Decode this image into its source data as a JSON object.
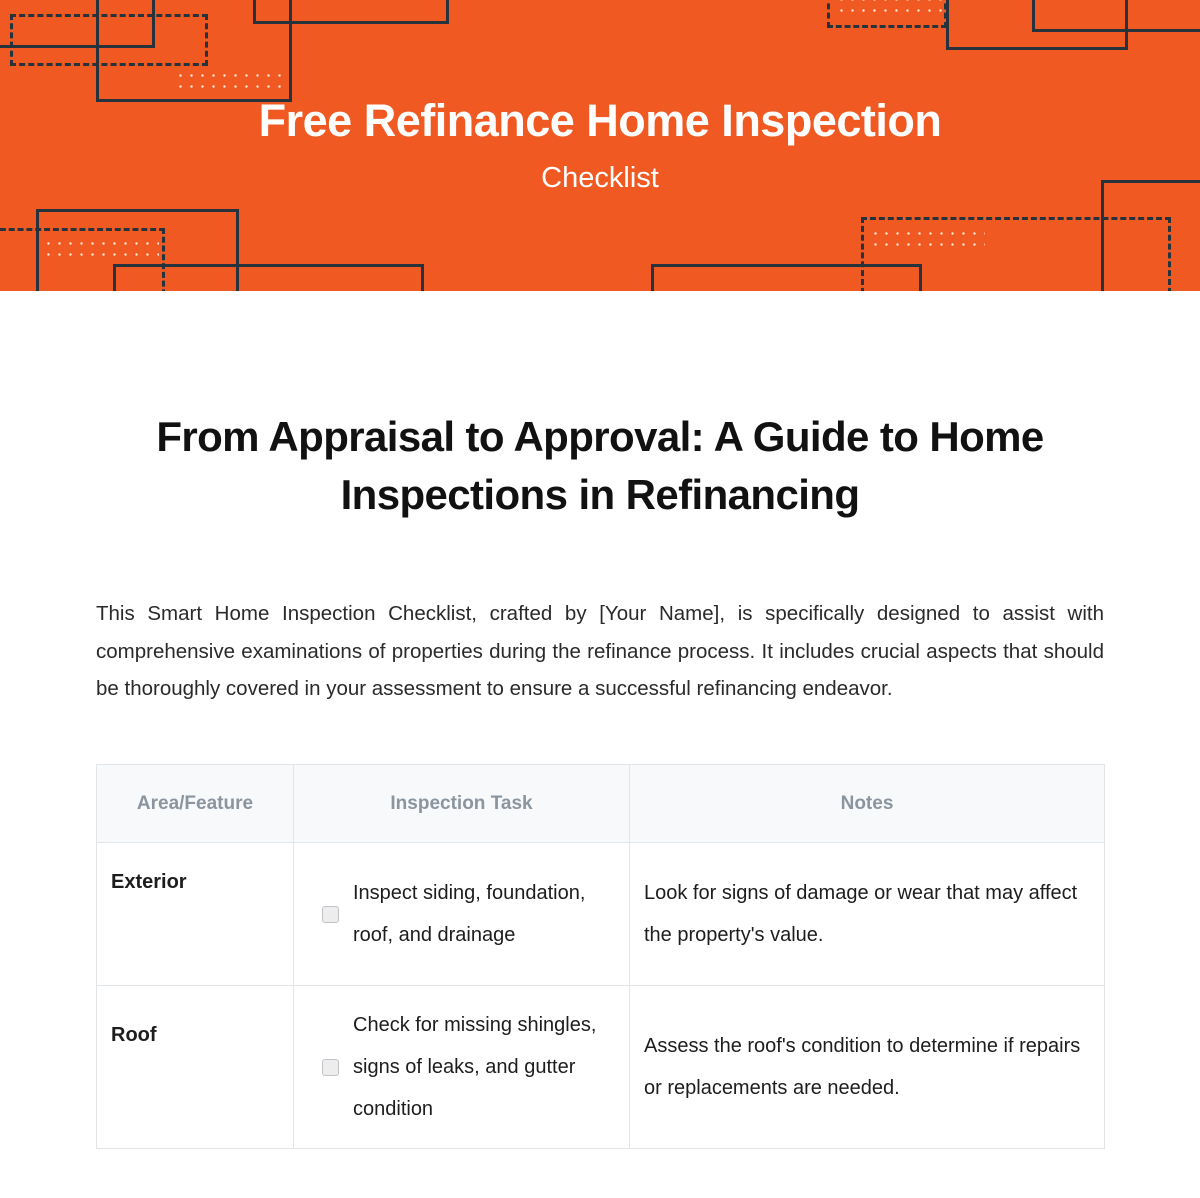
{
  "banner": {
    "title": "Free Refinance Home Inspection",
    "subtitle": "Checklist",
    "background_color": "#F05A22",
    "shape_color": "#26333C",
    "dot_color": "#FFEBDF",
    "text_color": "#FFFFFF"
  },
  "document": {
    "title": "From Appraisal to Approval: A Guide to Home Inspections in Refinancing",
    "intro": "This Smart Home Inspection Checklist, crafted by [Your Name], is specifically designed to assist with comprehensive examinations of properties during the refinance process. It includes crucial aspects that should be thoroughly covered in your assessment to ensure a successful refinancing endeavor."
  },
  "table": {
    "header_background": "#F7F9FA",
    "header_text_color": "#8A95A0",
    "border_color": "#E2E5E8",
    "columns": [
      {
        "label": "Area/Feature"
      },
      {
        "label": "Inspection Task"
      },
      {
        "label": "Notes"
      }
    ],
    "rows": [
      {
        "area": "Exterior",
        "task": "Inspect siding, foundation, roof, and drainage",
        "notes": "Look for signs of damage or wear that may affect the property's value.",
        "checked": false
      },
      {
        "area": "Roof",
        "task": "Check for missing shingles, signs of leaks, and gutter condition",
        "notes": "Assess the roof's condition to determine if repairs or replacements are needed.",
        "checked": false
      }
    ]
  }
}
